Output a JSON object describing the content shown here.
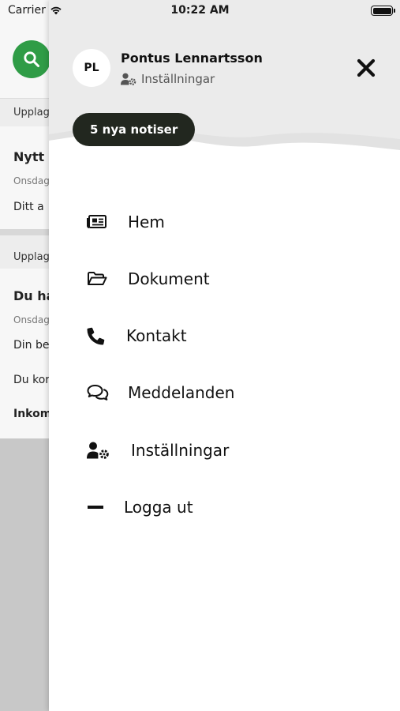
{
  "status_bar": {
    "carrier": "Carrier",
    "time": "10:22 AM"
  },
  "background": {
    "section1_label": "Upplag",
    "item1_title": "Nytt",
    "item1_date": "Onsdag",
    "item1_body": "Ditt a",
    "section2_label": "Upplag",
    "item2_title": "Du ha",
    "item2_date": "Onsdag",
    "item2_line1": "Din be",
    "item2_line2": "Du kor",
    "item2_line3": "Inkom"
  },
  "drawer": {
    "avatar_initials": "PL",
    "user_name": "Pontus Lennartsson",
    "settings_link": "Inställningar",
    "notifications_button": "5 nya notiser",
    "menu": [
      {
        "label": "Hem",
        "icon": "newspaper-icon"
      },
      {
        "label": "Dokument",
        "icon": "folder-open-icon"
      },
      {
        "label": "Kontakt",
        "icon": "phone-icon"
      },
      {
        "label": "Meddelanden",
        "icon": "chat-bubbles-icon"
      },
      {
        "label": "Inställningar",
        "icon": "user-settings-icon"
      },
      {
        "label": "Logga ut",
        "icon": "minus-icon"
      }
    ]
  },
  "colors": {
    "accent_green": "#2f9c46",
    "notis_button_bg": "#22271f",
    "header_bg": "#e9e9e9"
  }
}
